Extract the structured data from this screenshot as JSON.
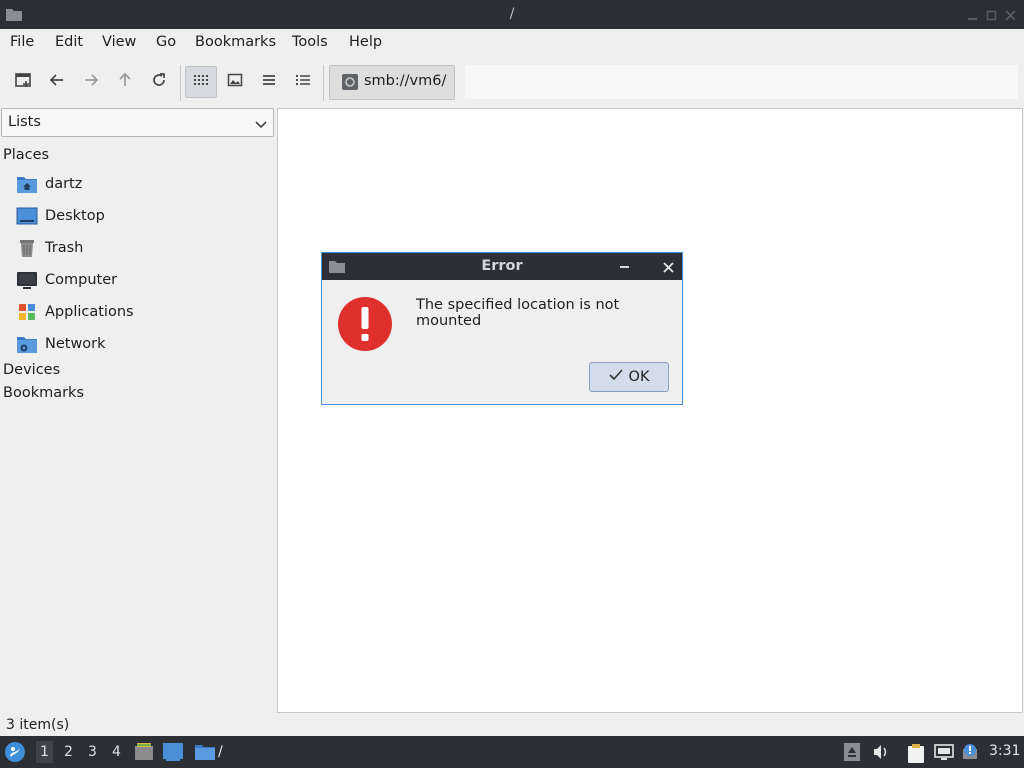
{
  "window": {
    "title": "/"
  },
  "menu": [
    "File",
    "Edit",
    "View",
    "Go",
    "Bookmarks",
    "Tools",
    "Help"
  ],
  "toolbar": {
    "path_button": "smb://vm6/",
    "buttons": [
      "new-tab-icon",
      "back-icon",
      "forward-icon",
      "up-icon",
      "reload-icon",
      "icon-view-icon",
      "thumbnail-view-icon",
      "compact-view-icon",
      "detailed-list-icon"
    ]
  },
  "side_panel": {
    "mode": "Lists",
    "places_heading": "Places",
    "places": [
      {
        "label": "dartz",
        "icon": "home-folder-icon"
      },
      {
        "label": "Desktop",
        "icon": "desktop-icon"
      },
      {
        "label": "Trash",
        "icon": "trash-icon"
      },
      {
        "label": "Computer",
        "icon": "computer-icon"
      },
      {
        "label": "Applications",
        "icon": "applications-icon"
      },
      {
        "label": "Network",
        "icon": "network-folder-icon"
      }
    ],
    "devices_heading": "Devices",
    "bookmarks_heading": "Bookmarks"
  },
  "status": {
    "items": "3 item(s)"
  },
  "dialog": {
    "title": "Error",
    "message": "The specified location is not mounted",
    "ok_label": "OK"
  },
  "taskbar": {
    "workspaces": [
      "1",
      "2",
      "3",
      "4"
    ],
    "window_label": "/",
    "clock": "3:31"
  },
  "colors": {
    "titlebar": "#2c2f36",
    "dialog_border": "#4a90d9",
    "error_red": "#e0302d",
    "folder_blue": "#4a8fd8"
  }
}
